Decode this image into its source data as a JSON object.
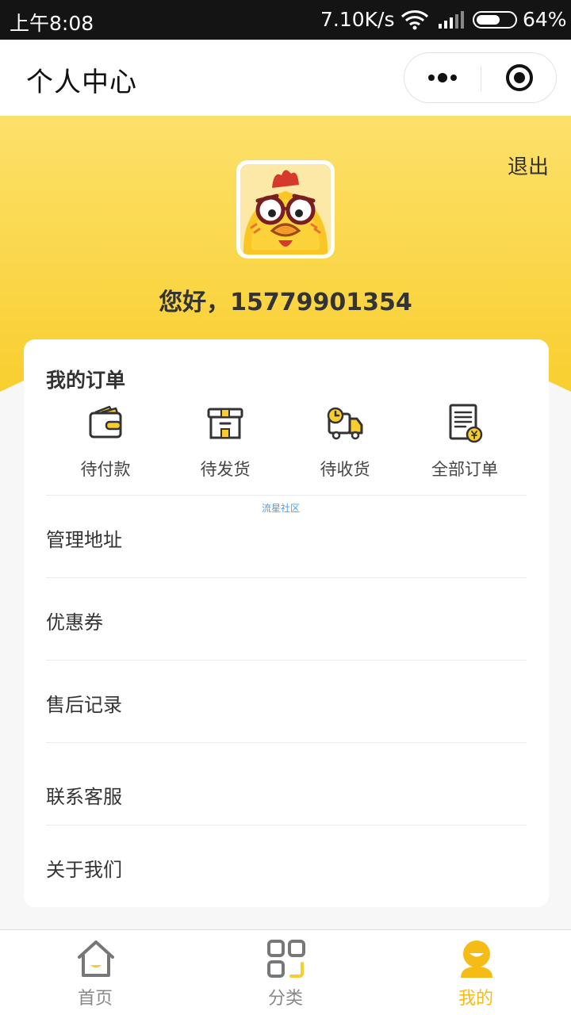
{
  "status_bar": {
    "time": "上午8:08",
    "network_speed": "7.10K/s",
    "battery_percent": "64%",
    "battery_level": 0.64
  },
  "nav": {
    "title": "个人中心",
    "more_icon": "more-dots-icon",
    "close_icon": "close-circle-icon"
  },
  "header": {
    "logout_label": "退出",
    "greeting": "您好，15779901354",
    "colors": {
      "top": "#fde06a",
      "bottom": "#f8cf2f"
    }
  },
  "orders": {
    "title": "我的订单",
    "items": [
      {
        "label": "待付款",
        "icon": "wallet-icon"
      },
      {
        "label": "待发货",
        "icon": "package-box-icon"
      },
      {
        "label": "待收货",
        "icon": "delivery-truck-icon"
      },
      {
        "label": "全部订单",
        "icon": "order-list-icon"
      }
    ]
  },
  "watermark": "流星社区",
  "menu": [
    {
      "label": "管理地址"
    },
    {
      "label": "优惠券"
    },
    {
      "label": "售后记录"
    },
    {
      "label": "联系客服"
    },
    {
      "label": "关于我们"
    }
  ],
  "tabs": [
    {
      "label": "首页",
      "icon": "home-icon",
      "active": false
    },
    {
      "label": "分类",
      "icon": "category-icon",
      "active": false
    },
    {
      "label": "我的",
      "icon": "profile-icon",
      "active": true
    }
  ],
  "colors": {
    "accent": "#f6bc16",
    "accent_light": "#fbd53a"
  }
}
